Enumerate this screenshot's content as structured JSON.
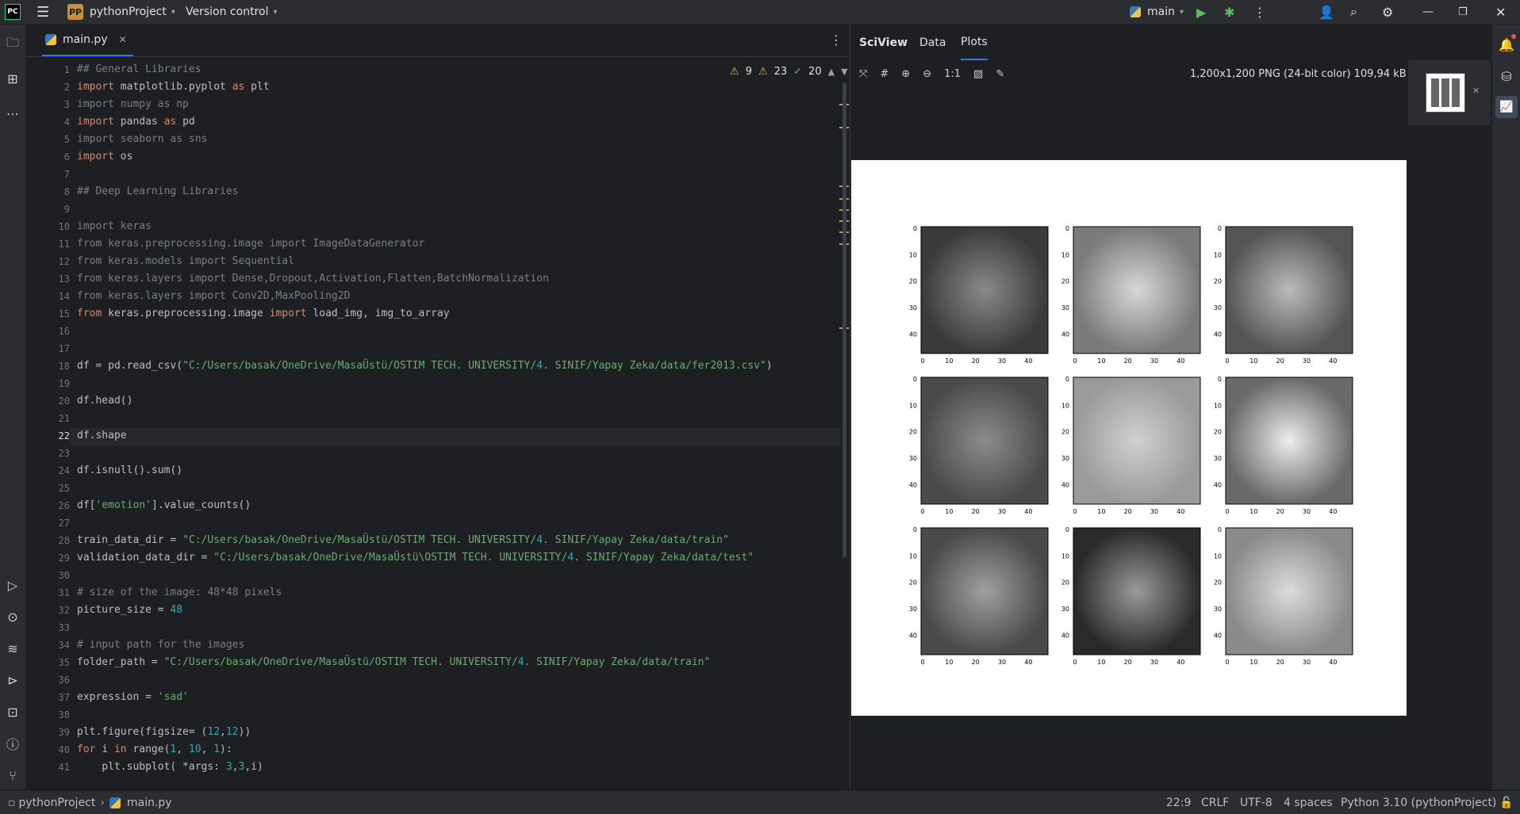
{
  "titlebar": {
    "app_badge": "PC",
    "project_badge": "PP",
    "project_name": "pythonProject",
    "version_control": "Version control",
    "run_config": "main"
  },
  "editor": {
    "tab_label": "main.py",
    "inspections": {
      "warnings": "9",
      "weak_warnings": "23",
      "ok": "20"
    },
    "current_line": 22
  },
  "code_lines": [
    {
      "n": "1",
      "t": "## General Libraries"
    },
    {
      "n": "2",
      "t": "import matplotlib.pyplot as plt"
    },
    {
      "n": "3",
      "t": "import numpy as np"
    },
    {
      "n": "4",
      "t": "import pandas as pd"
    },
    {
      "n": "5",
      "t": "import seaborn as sns"
    },
    {
      "n": "6",
      "t": "import os"
    },
    {
      "n": "7",
      "t": ""
    },
    {
      "n": "8",
      "t": "## Deep Learning Libraries"
    },
    {
      "n": "9",
      "t": ""
    },
    {
      "n": "10",
      "t": "import keras"
    },
    {
      "n": "11",
      "t": "from keras.preprocessing.image import ImageDataGenerator"
    },
    {
      "n": "12",
      "t": "from keras.models import Sequential"
    },
    {
      "n": "13",
      "t": "from keras.layers import Dense,Dropout,Activation,Flatten,BatchNormalization"
    },
    {
      "n": "14",
      "t": "from keras.layers import Conv2D,MaxPooling2D"
    },
    {
      "n": "15",
      "t": "from keras.preprocessing.image import load_img, img_to_array"
    },
    {
      "n": "16",
      "t": ""
    },
    {
      "n": "17",
      "t": ""
    },
    {
      "n": "18",
      "t": "df = pd.read_csv(\"C:/Users/basak/OneDrive/MasaÜstü/OSTIM TECH. UNIVERSITY/4. SINIF/Yapay Zeka/data/fer2013.csv\")"
    },
    {
      "n": "19",
      "t": ""
    },
    {
      "n": "20",
      "t": "df.head()"
    },
    {
      "n": "21",
      "t": ""
    },
    {
      "n": "22",
      "t": "df.shape"
    },
    {
      "n": "23",
      "t": ""
    },
    {
      "n": "24",
      "t": "df.isnull().sum()"
    },
    {
      "n": "25",
      "t": ""
    },
    {
      "n": "26",
      "t": "df['emotion'].value_counts()"
    },
    {
      "n": "27",
      "t": ""
    },
    {
      "n": "28",
      "t": "train_data_dir = \"C:/Users/basak/OneDrive/MasaÜstü/OSTIM TECH. UNIVERSITY/4. SINIF/Yapay Zeka/data/train\""
    },
    {
      "n": "29",
      "t": "validation_data_dir = \"C:/Users/basak/OneDrive/MasaÜstü\\OSTIM TECH. UNIVERSITY/4. SINIF/Yapay Zeka/data/test\""
    },
    {
      "n": "30",
      "t": ""
    },
    {
      "n": "31",
      "t": "# size of the image: 48*48 pixels"
    },
    {
      "n": "32",
      "t": "picture_size = 48"
    },
    {
      "n": "33",
      "t": ""
    },
    {
      "n": "34",
      "t": "# input path for the images"
    },
    {
      "n": "35",
      "t": "folder_path = \"C:/Users/basak/OneDrive/MasaÜstü/OSTIM TECH. UNIVERSITY/4. SINIF/Yapay Zeka/data/train\""
    },
    {
      "n": "36",
      "t": ""
    },
    {
      "n": "37",
      "t": "expression = 'sad'"
    },
    {
      "n": "38",
      "t": ""
    },
    {
      "n": "39",
      "t": "plt.figure(figsize= (12,12))"
    },
    {
      "n": "40",
      "t": "for i in range(1, 10, 1):"
    },
    {
      "n": "41",
      "t": "    plt.subplot( *args: 3,3,i)"
    }
  ],
  "sciview": {
    "title": "SciView",
    "tabs": [
      "Data",
      "Plots"
    ],
    "active_tab": "Plots",
    "zoom_label": "1:1",
    "image_info": "1,200x1,200 PNG (24-bit color) 109,94 kB",
    "axis_ticks": [
      "0",
      "10",
      "20",
      "30",
      "40"
    ]
  },
  "statusbar": {
    "project": "pythonProject",
    "file": "main.py",
    "position": "22:9",
    "line_sep": "CRLF",
    "encoding": "UTF-8",
    "indent": "4 spaces",
    "interpreter": "Python 3.10 (pythonProject)"
  },
  "colors": {
    "accent": "#3574f0",
    "warning": "#e0b03a",
    "ok": "#5fb865"
  }
}
